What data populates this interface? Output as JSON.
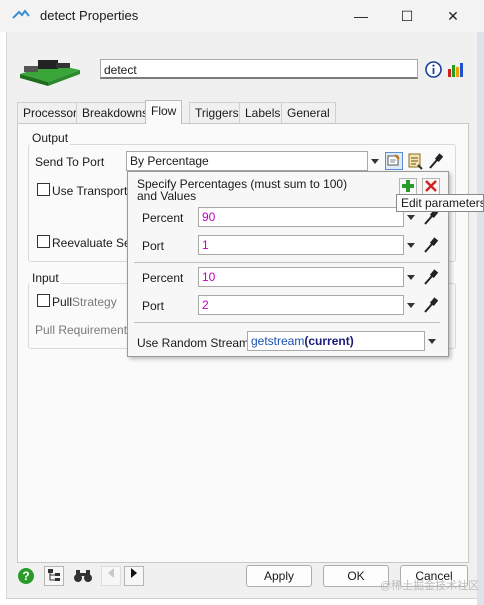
{
  "window": {
    "title": "detect  Properties",
    "minimize_glyph": "—",
    "maximize_glyph": "☐",
    "close_glyph": "✕"
  },
  "object": {
    "name": "detect"
  },
  "tabs": [
    {
      "label": "Processor"
    },
    {
      "label": "Breakdowns"
    },
    {
      "label": "Flow",
      "active": true
    },
    {
      "label": "Triggers"
    },
    {
      "label": "Labels"
    },
    {
      "label": "General"
    }
  ],
  "output": {
    "group_label": "Output",
    "send_to_port_label": "Send To Port",
    "send_to_port_value": "By Percentage",
    "use_transport_label": "Use Transport",
    "reevaluate_label": "Reevaluate Sen"
  },
  "input": {
    "group_label": "Input",
    "pull_label": "Pull",
    "strategy_label": "Strategy",
    "pull_requirement_label": "Pull Requirement"
  },
  "popup": {
    "header_line1": "Specify Percentages (must sum to 100)",
    "header_line2": "and Values",
    "rows": [
      {
        "percent_label": "Percent",
        "percent_value": "90",
        "port_label": "Port",
        "port_value": "1"
      },
      {
        "percent_label": "Percent",
        "percent_value": "10",
        "port_label": "Port",
        "port_value": "2"
      }
    ],
    "random_stream_label": "Use Random Stream",
    "random_stream_func": "getstream",
    "random_stream_arg": "(current)"
  },
  "tooltip": {
    "text": "Edit parameters fo"
  },
  "buttons": {
    "apply": "Apply",
    "ok": "OK",
    "cancel": "Cancel"
  },
  "watermark": "@稀土掘金技术社区",
  "colors": {
    "magenta_value": "#c000c0",
    "stream_func": "#1a4fb0",
    "stream_arg": "#1a1a7a"
  },
  "icons": [
    "app-icon",
    "object-3d-icon",
    "info-icon",
    "stats-icon",
    "edit-parameters-icon",
    "code-edit-icon",
    "eyedropper-icon",
    "add-icon",
    "remove-icon",
    "help-icon",
    "tree-icon",
    "find-icon",
    "prev-arrow-icon",
    "next-arrow-icon"
  ]
}
